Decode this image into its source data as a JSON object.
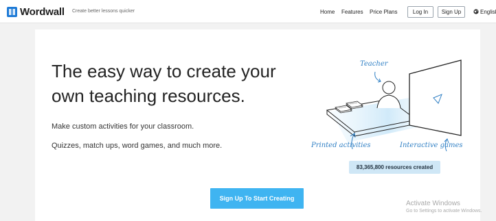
{
  "header": {
    "brand": "Wordwall",
    "tagline": "Create better lessons quicker",
    "nav": [
      "Home",
      "Features",
      "Price Plans"
    ],
    "login_label": "Log In",
    "signup_label": "Sign Up",
    "language_label": "English"
  },
  "hero": {
    "headline_line1": "The easy way to create your",
    "headline_line2": "own teaching resources.",
    "subtitle1": "Make custom activities for your classroom.",
    "subtitle2": "Quizzes, match ups, word games, and much more.",
    "cta_label": "Sign Up To Start Creating"
  },
  "illustration": {
    "teacher_label": "Teacher",
    "printed_label": "Printed activities",
    "interactive_label": "Interactive games",
    "resources_count": "83,365,800 resources created"
  },
  "watermark": {
    "line1": "Activate Windows",
    "line2": "Go to Settings to activate Windows."
  },
  "colors": {
    "brand_blue": "#1f7bd6",
    "cta_blue": "#3fb4f1",
    "label_blue": "#2f7fc4",
    "counter_bg": "#cfe7f6"
  }
}
